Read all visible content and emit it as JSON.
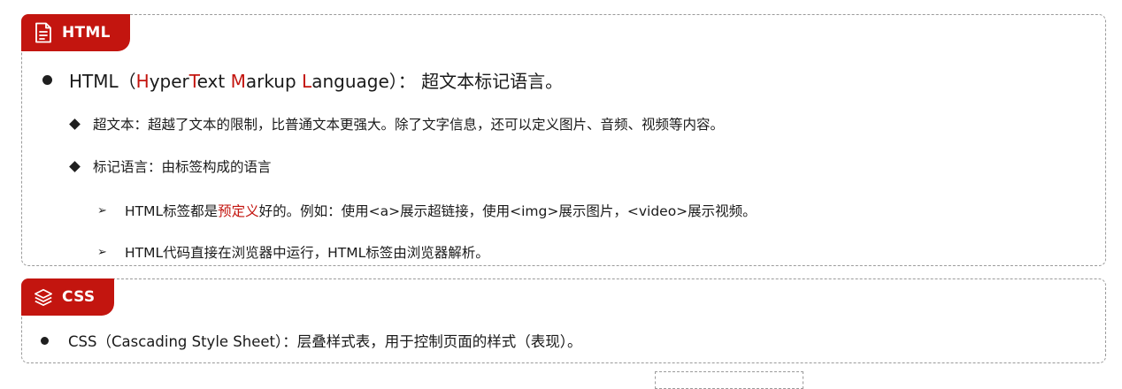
{
  "html_section": {
    "tag_label": "HTML",
    "tag_icon": "document-icon",
    "definition": {
      "prefix": "HTML（",
      "h": "H",
      "yper": "yper",
      "t": "T",
      "ext": "ext ",
      "m": "M",
      "arkup": "arkup ",
      "l": "L",
      "anguage": "anguage",
      "suffix": "）：  超文本标记语言。"
    },
    "hypertext": "超文本：超越了文本的限制，比普通文本更强大。除了文字信息，还可以定义图片、音频、视频等内容。",
    "markup_language": "标记语言：由标签构成的语言",
    "predefined": {
      "prefix": "HTML标签都是",
      "highlight": "预定义",
      "suffix": "好的。例如：使用<a>展示超链接，使用<img>展示图片，<video>展示视频。"
    },
    "browser": "HTML代码直接在浏览器中运行，HTML标签由浏览器解析。"
  },
  "css_section": {
    "tag_label": "CSS",
    "tag_icon": "layers-icon",
    "definition": "CSS（Cascading Style Sheet）：层叠样式表，用于控制页面的样式（表现）。"
  },
  "colors": {
    "accent": "#c3150f",
    "text": "#1a1a1a",
    "border": "#9a9a9a"
  }
}
